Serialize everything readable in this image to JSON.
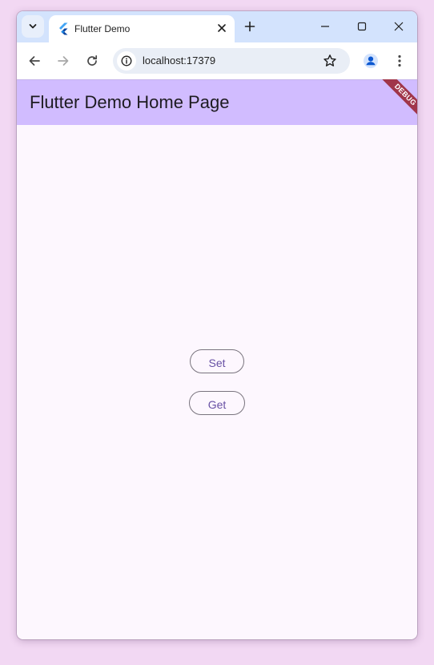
{
  "browser": {
    "tab_title": "Flutter Demo",
    "url": "localhost:17379"
  },
  "app": {
    "title": "Flutter Demo Home Page",
    "debug_banner": "DEBUG",
    "appbar_color": "#d1bcff",
    "accent_color": "#6750a4"
  },
  "buttons": {
    "set_label": "Set",
    "get_label": "Get"
  }
}
